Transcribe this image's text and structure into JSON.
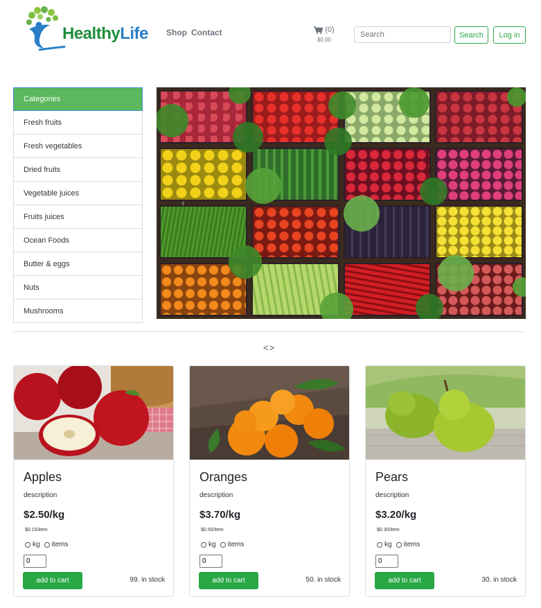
{
  "header": {
    "logo_text_1": "Healthy",
    "logo_text_2": "Life",
    "nav": {
      "shop": "Shop",
      "contact": "Contact"
    },
    "cart": {
      "count": "(0)",
      "total": "$0.00",
      "icon": "cart-icon"
    },
    "search": {
      "placeholder": "Search",
      "button": "Search"
    },
    "login": "Log in"
  },
  "categories": {
    "title": "Categories",
    "items": [
      "Fresh fruits",
      "Fresh vegetables",
      "Dried fruits",
      "Vegetable juices",
      "Fruits juices",
      "Ocean Foods",
      "Butter & eggs",
      "Nuts",
      "Mushrooms"
    ]
  },
  "hero": {
    "prev_icon": "chevron-left-icon"
  },
  "carousel": {
    "controls": "<>"
  },
  "products": [
    {
      "name": "Apples",
      "description": "description",
      "price": "$2.50/kg",
      "unit_price": "$0.15/item",
      "opt_kg": "kg",
      "opt_items": "items",
      "qty": "0",
      "add": "add to cart",
      "stock": "99. in stock"
    },
    {
      "name": "Oranges",
      "description": "description",
      "price": "$3.70/kg",
      "unit_price": "$0.50/item",
      "opt_kg": "kg",
      "opt_items": "items",
      "qty": "0",
      "add": "add to cart",
      "stock": "50. in stock"
    },
    {
      "name": "Pears",
      "description": "description",
      "price": "$3.20/kg",
      "unit_price": "$0.30/item",
      "opt_kg": "kg",
      "opt_items": "items",
      "qty": "0",
      "add": "add to cart",
      "stock": "30. in stock"
    }
  ],
  "colors": {
    "brand_green": "#28a745",
    "category_header": "#5cb85c"
  }
}
